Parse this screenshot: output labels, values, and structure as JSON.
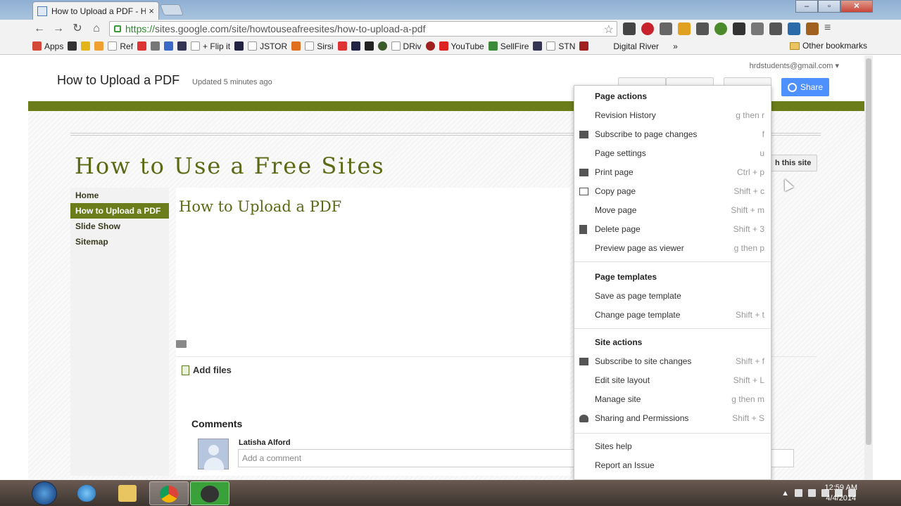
{
  "browser": {
    "tab_title": "How to Upload a PDF - Hc",
    "tab_close": "×",
    "url_scheme": "https://",
    "url_rest": "sites.google.com/site/howtouseafreesites/how-to-upload-a-pdf",
    "bookmarks": [
      "Apps",
      "Ref",
      "+ Flip it",
      "JSTOR",
      "Sirsi",
      "DRiv",
      "YouTube",
      "SellFire",
      "STN",
      "Digital River"
    ],
    "more_chevron": "»",
    "other_bookmarks": "Other bookmarks"
  },
  "site": {
    "page_title": "How to Upload a PDF",
    "updated": "Updated 5 minutes ago",
    "account": "hrdstudents@gmail.com ▾",
    "share_label": "Share",
    "site_title": "How to Use a Free Sites",
    "search_label": "h this site",
    "nav": [
      "Home",
      "How to Upload a PDF",
      "Slide Show",
      "Sitemap"
    ],
    "page_heading": "How to Upload a PDF",
    "add_files": "Add files",
    "comments_title": "Comments",
    "commenter": "Latisha Alford",
    "comment_placeholder": "Add a comment"
  },
  "menu": {
    "page_actions_title": "Page actions",
    "page_actions": [
      {
        "label": "Revision History",
        "shortcut": "g then r",
        "icon": ""
      },
      {
        "label": "Subscribe to page changes",
        "shortcut": "f",
        "icon": "mail-icon"
      },
      {
        "label": "Page settings",
        "shortcut": "u",
        "icon": ""
      },
      {
        "label": "Print page",
        "shortcut": "Ctrl + p",
        "icon": "printer-icon"
      },
      {
        "label": "Copy page",
        "shortcut": "Shift + c",
        "icon": "copy-icon"
      },
      {
        "label": "Move page",
        "shortcut": "Shift + m",
        "icon": ""
      },
      {
        "label": "Delete page",
        "shortcut": "Shift + 3",
        "icon": "trash-icon"
      },
      {
        "label": "Preview page as viewer",
        "shortcut": "g then p",
        "icon": ""
      }
    ],
    "page_templates_title": "Page templates",
    "page_templates": [
      {
        "label": "Save as page template",
        "shortcut": "",
        "icon": ""
      },
      {
        "label": "Change page template",
        "shortcut": "Shift + t",
        "icon": ""
      }
    ],
    "site_actions_title": "Site actions",
    "site_actions": [
      {
        "label": "Subscribe to site changes",
        "shortcut": "Shift + f",
        "icon": "mail-icon"
      },
      {
        "label": "Edit site layout",
        "shortcut": "Shift + L",
        "icon": ""
      },
      {
        "label": "Manage site",
        "shortcut": "g then m",
        "icon": ""
      },
      {
        "label": "Sharing and Permissions",
        "shortcut": "Shift + S",
        "icon": "add-person-icon"
      }
    ],
    "footer": [
      {
        "label": "Sites help",
        "shortcut": "",
        "icon": ""
      },
      {
        "label": "Report an Issue",
        "shortcut": "",
        "icon": ""
      }
    ]
  },
  "taskbar": {
    "time": "12:59 AM",
    "date": "4/4/2014"
  },
  "colors": {
    "accent_green": "#6b7d1a",
    "share_blue": "#4d90fe"
  }
}
